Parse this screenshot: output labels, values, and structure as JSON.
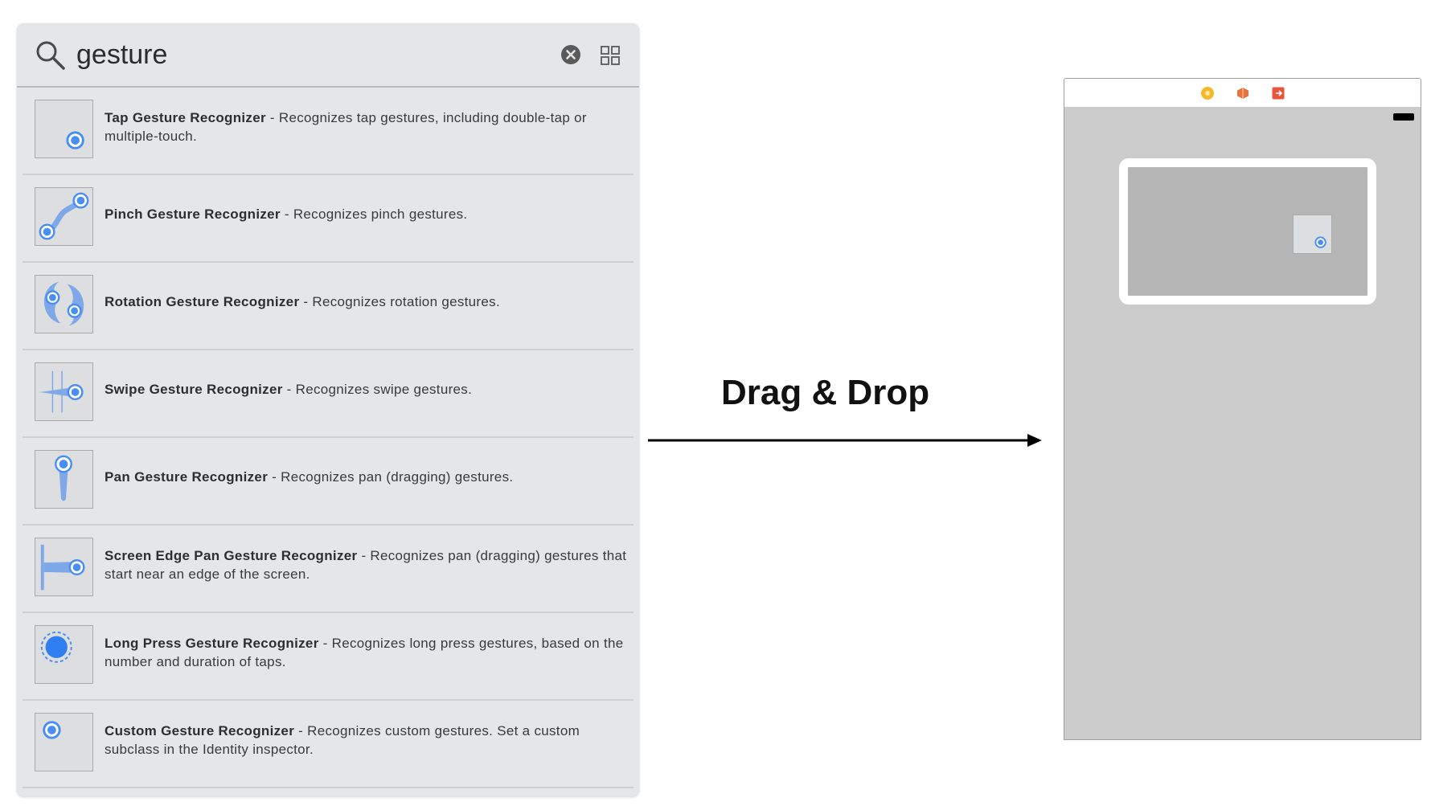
{
  "search": {
    "value": "gesture"
  },
  "items": [
    {
      "name": "Tap Gesture Recognizer",
      "desc": " - Recognizes tap gestures, including double-tap or multiple-touch.",
      "icon": "tap-gesture-icon"
    },
    {
      "name": "Pinch Gesture Recognizer",
      "desc": " - Recognizes pinch gestures.",
      "icon": "pinch-gesture-icon"
    },
    {
      "name": "Rotation Gesture Recognizer",
      "desc": " - Recognizes rotation gestures.",
      "icon": "rotation-gesture-icon"
    },
    {
      "name": "Swipe Gesture Recognizer",
      "desc": " - Recognizes swipe gestures.",
      "icon": "swipe-gesture-icon"
    },
    {
      "name": "Pan Gesture Recognizer",
      "desc": " - Recognizes pan (dragging) gestures.",
      "icon": "pan-gesture-icon"
    },
    {
      "name": "Screen Edge Pan Gesture Recognizer",
      "desc": " - Recognizes pan (dragging) gestures that start near an edge of the screen.",
      "icon": "screen-edge-pan-gesture-icon"
    },
    {
      "name": "Long Press Gesture Recognizer",
      "desc": " - Recognizes long press gestures, based on the number and duration of taps.",
      "icon": "long-press-gesture-icon"
    },
    {
      "name": "Custom Gesture Recognizer",
      "desc": " - Recognizes custom gestures. Set a custom subclass in the Identity inspector.",
      "icon": "custom-gesture-icon"
    }
  ],
  "annotation": {
    "label": "Drag & Drop"
  },
  "colors": {
    "accent_blue": "#4a8ef0",
    "gesture_blue": "#7fa8e8",
    "panel_bg": "#e5e6e8",
    "scene_dot_yellow": "#f5b829",
    "scene_dot_orange": "#e8743b",
    "scene_dot_red": "#e8553b"
  }
}
